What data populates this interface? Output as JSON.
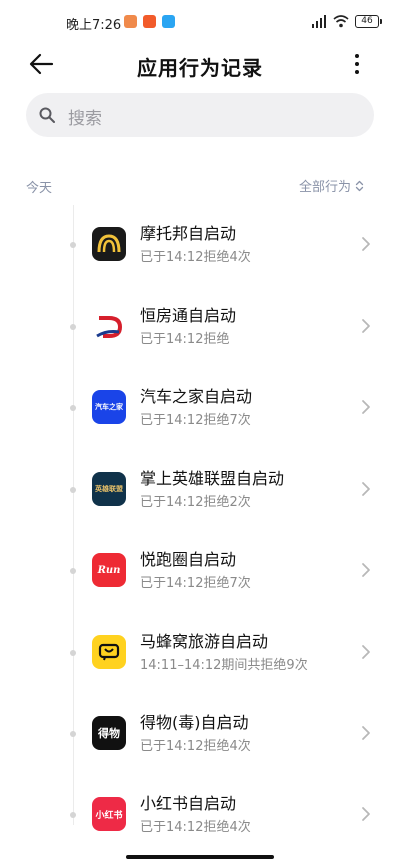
{
  "status_bar": {
    "time": "晚上7:26",
    "battery": "46",
    "network": "HD"
  },
  "header": {
    "title": "应用行为记录",
    "back_icon": "arrow-left-icon",
    "more_icon": "more-vertical-icon"
  },
  "search": {
    "placeholder": "搜索"
  },
  "filter": {
    "date_label": "今天",
    "filter_label": "全部行为"
  },
  "items": [
    {
      "title": "摩托邦自启动",
      "subtitle": "已于14:12拒绝4次",
      "icon": "motobang-app-icon",
      "color": "#1a1a1a"
    },
    {
      "title": "恒房通自启动",
      "subtitle": "已于14:12拒绝",
      "icon": "hengfangtong-app-icon",
      "color": "#ffffff"
    },
    {
      "title": "汽车之家自启动",
      "subtitle": "已于14:12拒绝7次",
      "icon": "autohome-app-icon",
      "color": "#1a44e8"
    },
    {
      "title": "掌上英雄联盟自启动",
      "subtitle": "已于14:12拒绝2次",
      "icon": "lol-app-icon",
      "color": "#10324a"
    },
    {
      "title": "悦跑圈自启动",
      "subtitle": "已于14:12拒绝7次",
      "icon": "joyrun-app-icon",
      "color": "#ee2a34"
    },
    {
      "title": "马蜂窝旅游自启动",
      "subtitle": "14:11–14:12期间共拒绝9次",
      "icon": "mafengwo-app-icon",
      "color": "#ffd21f"
    },
    {
      "title": "得物(毒)自启动",
      "subtitle": "已于14:12拒绝4次",
      "icon": "dewu-app-icon",
      "color": "#111111"
    },
    {
      "title": "小红书自启动",
      "subtitle": "已于14:12拒绝4次",
      "icon": "xiaohongshu-app-icon",
      "color": "#ee2a46"
    }
  ],
  "app_icon_text": {
    "autohome": "汽车之家",
    "lol": "英雄联盟",
    "joyrun": "Run",
    "dewu": "得物",
    "xiaohongshu": "小红书"
  }
}
